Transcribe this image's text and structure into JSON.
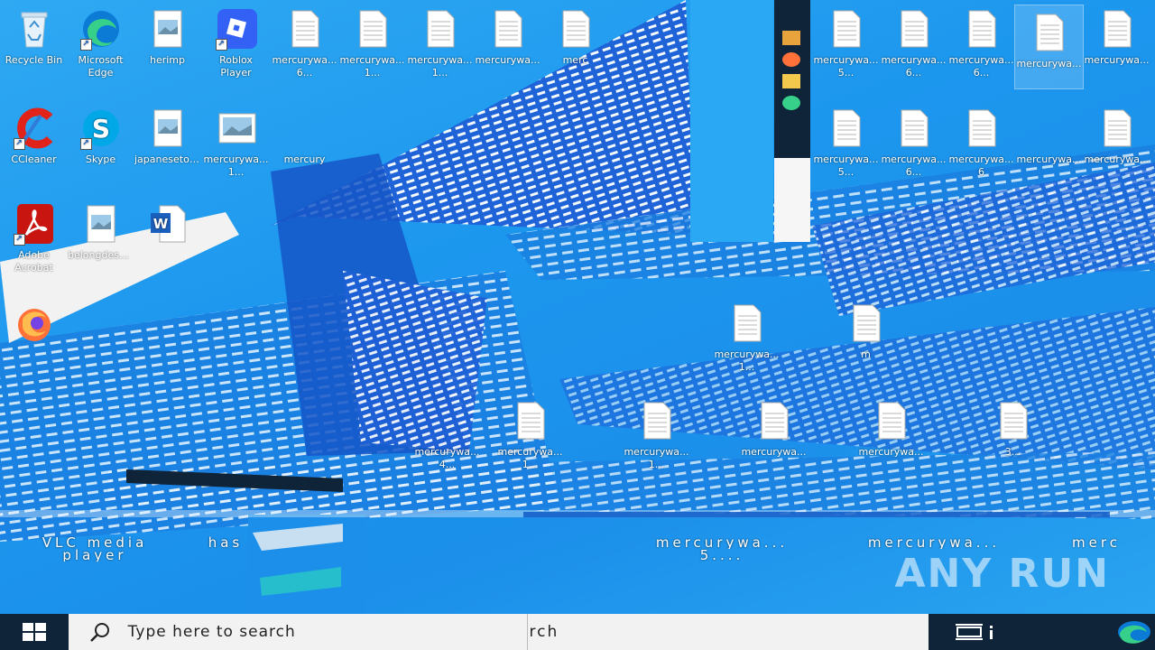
{
  "desktop": {
    "icons": [
      {
        "name": "recycle-bin",
        "label": "Recycle Bin",
        "sub": "",
        "kind": "recycle"
      },
      {
        "name": "microsoft-edge",
        "label": "Microsoft",
        "sub": "Edge",
        "kind": "edge"
      },
      {
        "name": "herimp",
        "label": "herimp",
        "sub": "",
        "kind": "image"
      },
      {
        "name": "roblox",
        "label": "Roblox",
        "sub": "Player",
        "kind": "roblox"
      },
      {
        "name": "mercurywa-1",
        "label": "mercurywa...",
        "sub": "6...",
        "kind": "doc"
      },
      {
        "name": "mercurywa-2",
        "label": "mercurywa...",
        "sub": "1...",
        "kind": "doc"
      },
      {
        "name": "mercurywa-3",
        "label": "mercurywa...",
        "sub": "1...",
        "kind": "doc"
      },
      {
        "name": "mercurywa-4",
        "label": "mercurywa...",
        "sub": "",
        "kind": "doc"
      },
      {
        "name": "mercurywa-5",
        "label": "merc",
        "sub": "",
        "kind": "doc"
      },
      {
        "name": "mercurywa-6",
        "label": "mercurywa...",
        "sub": "5...",
        "kind": "doc"
      },
      {
        "name": "mercurywa-7",
        "label": "mercurywa...",
        "sub": "6...",
        "kind": "doc"
      },
      {
        "name": "mercurywa-8",
        "label": "mercurywa...",
        "sub": "6...",
        "kind": "doc"
      },
      {
        "name": "mercurywa-9",
        "label": "mercurywa...",
        "sub": "",
        "kind": "doc",
        "selected": true
      },
      {
        "name": "mercurywa-10",
        "label": "mercurywa...",
        "sub": "",
        "kind": "doc"
      },
      {
        "name": "ccleaner",
        "label": "CCleaner",
        "sub": "",
        "kind": "ccleaner"
      },
      {
        "name": "skype",
        "label": "Skype",
        "sub": "",
        "kind": "skype"
      },
      {
        "name": "japanesetot",
        "label": "japanesetot...",
        "sub": "",
        "kind": "image"
      },
      {
        "name": "mercurywa-11",
        "label": "mercurywa...",
        "sub": "1...",
        "kind": "image"
      },
      {
        "name": "mercurywa-12",
        "label": "mercury",
        "sub": "",
        "kind": "doc"
      },
      {
        "name": "mercurywa-13",
        "label": "mercurywa...",
        "sub": "5...",
        "kind": "doc"
      },
      {
        "name": "mercurywa-14",
        "label": "mercurywa...",
        "sub": "6...",
        "kind": "doc"
      },
      {
        "name": "mercurywa-15",
        "label": "mercurywa...",
        "sub": "6",
        "kind": "doc"
      },
      {
        "name": "mercurywa-16",
        "label": "mercurywa...",
        "sub": "",
        "kind": "doc"
      },
      {
        "name": "mercurywa-17",
        "label": "mercurywa...",
        "sub": "",
        "kind": "doc"
      },
      {
        "name": "adobe-acrobat",
        "label": "Adobe",
        "sub": "Acrobat",
        "kind": "acrobat"
      },
      {
        "name": "belongdesc",
        "label": "belongdesc...",
        "sub": "",
        "kind": "image"
      },
      {
        "name": "word-doc",
        "label": "",
        "sub": "",
        "kind": "word"
      },
      {
        "name": "firefox",
        "label": "",
        "sub": "",
        "kind": "firefox"
      },
      {
        "name": "mercurywa-18",
        "label": "mercurywa...",
        "sub": "1...",
        "kind": "doc"
      },
      {
        "name": "mercurywa-19",
        "label": "m",
        "sub": "",
        "kind": "doc"
      },
      {
        "name": "mercurywa-20",
        "label": "mercurywa...",
        "sub": "4...",
        "kind": "doc"
      },
      {
        "name": "mercurywa-21",
        "label": "mercurywa...",
        "sub": "1...",
        "kind": "doc"
      },
      {
        "name": "mercurywa-22",
        "label": "mercurywa...",
        "sub": "1...",
        "kind": "doc"
      },
      {
        "name": "mercurywa-23",
        "label": "mercurywa...",
        "sub": "",
        "kind": "doc"
      },
      {
        "name": "mercurywa-24",
        "label": "mercurywa...",
        "sub": "",
        "kind": "doc"
      },
      {
        "name": "mercurywa-25",
        "label": "",
        "sub": "3...",
        "kind": "doc"
      },
      {
        "name": "vlc-media-player",
        "label": "VLC media",
        "sub": "player",
        "kind": "vlc"
      },
      {
        "name": "has",
        "label": "has",
        "sub": "",
        "kind": "none"
      },
      {
        "name": "mercurywa-26",
        "label": "mercurywa...",
        "sub": "5....",
        "kind": "none"
      },
      {
        "name": "mercurywa-27",
        "label": "mercurywa...",
        "sub": "",
        "kind": "none"
      },
      {
        "name": "mercurywa-28",
        "label": "merc",
        "sub": "",
        "kind": "none"
      }
    ],
    "watermark": "ANY RUN"
  },
  "taskbar": {
    "search_placeholder": "Type here to search",
    "search_ghost": "rch"
  },
  "colors": {
    "wallpaper": "#1c97ee",
    "taskbar": "#0f2438",
    "accent": "#0b56c4"
  }
}
